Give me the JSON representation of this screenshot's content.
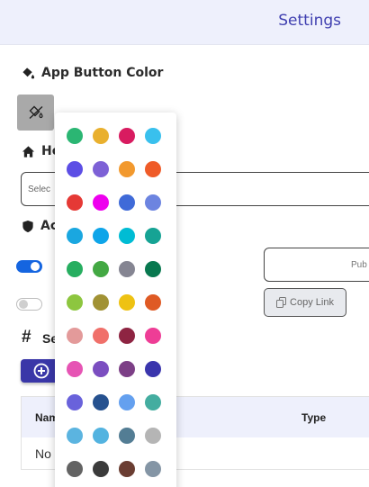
{
  "header": {
    "title": "Settings"
  },
  "app_button_color": {
    "heading": "App Button Color"
  },
  "home": {
    "heading_partial": "Ho",
    "select_placeholder_partial": "Selec"
  },
  "access": {
    "heading_partial": "Ac",
    "toggle1_on": true,
    "toggle2_on": false
  },
  "url_box": {
    "text_partial": "Pub"
  },
  "copy_link": {
    "label": "Copy Link"
  },
  "section3": {
    "heading_partial": "Se"
  },
  "table": {
    "col_name_partial": "Nam",
    "col_type": "Type",
    "row_text_partial": "No"
  },
  "colors": {
    "topbar_title": "#3f3fb0",
    "add_button": "#3a37a8",
    "toggle_on": "#1565e0",
    "swatches": [
      "#2bb673",
      "#e9b02e",
      "#d81b60",
      "#39c0ed",
      "#5c4ee5",
      "#7d61d6",
      "#f2992e",
      "#ef5b28",
      "#e53935",
      "#ee00ee",
      "#3f6ad8",
      "#6c84e0",
      "#1aa7e0",
      "#0ea5e9",
      "#00bcd4",
      "#16a394",
      "#27ae60",
      "#43a843",
      "#858592",
      "#08784f",
      "#8dc63f",
      "#a19234",
      "#eec213",
      "#df5a24",
      "#e39a9a",
      "#f0706a",
      "#8e2442",
      "#ee3d96",
      "#e654b4",
      "#7b4ec0",
      "#7c3f86",
      "#3a35ad",
      "#6962db",
      "#26518f",
      "#64a0ef",
      "#44ada0",
      "#5bb4e0",
      "#53b3e0",
      "#537d94",
      "#b5b5b5",
      "#636363",
      "#3b3b3b",
      "#6a3d32",
      "#8495a5"
    ]
  }
}
